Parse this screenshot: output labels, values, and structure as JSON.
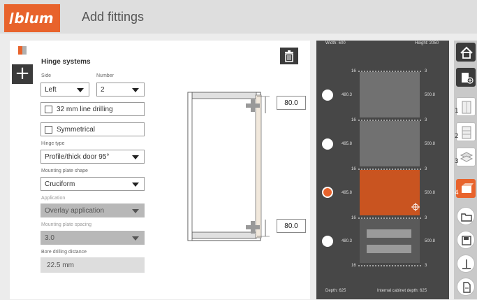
{
  "header": {
    "logo_text": "blum",
    "title": "Add fittings"
  },
  "form": {
    "section_title": "Hinge systems",
    "side": {
      "label": "Side",
      "value": "Left"
    },
    "number": {
      "label": "Number",
      "value": "2"
    },
    "line_drilling": {
      "label": "32 mm line drilling",
      "checked": false
    },
    "symmetrical": {
      "label": "Symmetrical",
      "checked": false
    },
    "hinge_type": {
      "label": "Hinge type",
      "value": "Profile/thick door 95°"
    },
    "mounting_plate_shape": {
      "label": "Mounting plate shape",
      "value": "Cruciform"
    },
    "application": {
      "label": "Application",
      "value": "Overlay application"
    },
    "mounting_plate_spacing": {
      "label": "Mounting plate spacing",
      "value": "3.0"
    },
    "bore_drilling_distance": {
      "label": "Bore drilling distance",
      "value": "22.5 mm"
    }
  },
  "drawing": {
    "top_value": "80.0",
    "bottom_value": "80.0"
  },
  "cabinet": {
    "width_label": "Width: 600",
    "height_label": "Height: 2050",
    "depth_label": "Depth: 625",
    "internal_depth_label": "Internal cabinet depth: 625",
    "left_values": [
      "480.3",
      "495.8",
      "495.8",
      "480.3"
    ],
    "right_values": [
      "500.8",
      "500.8",
      "500.8",
      "500.8"
    ],
    "gap_left": [
      "16",
      "16",
      "16",
      "16",
      "16"
    ],
    "gap_right": [
      "3",
      "3",
      "3",
      "3",
      "3"
    ],
    "selected_index": 2
  },
  "toolbar": {
    "step_numbers": [
      "1",
      "2",
      "3",
      "4"
    ]
  },
  "colors": {
    "brand": "#e8632c",
    "selected_part": "#c95420",
    "dark_panel": "#474747"
  }
}
